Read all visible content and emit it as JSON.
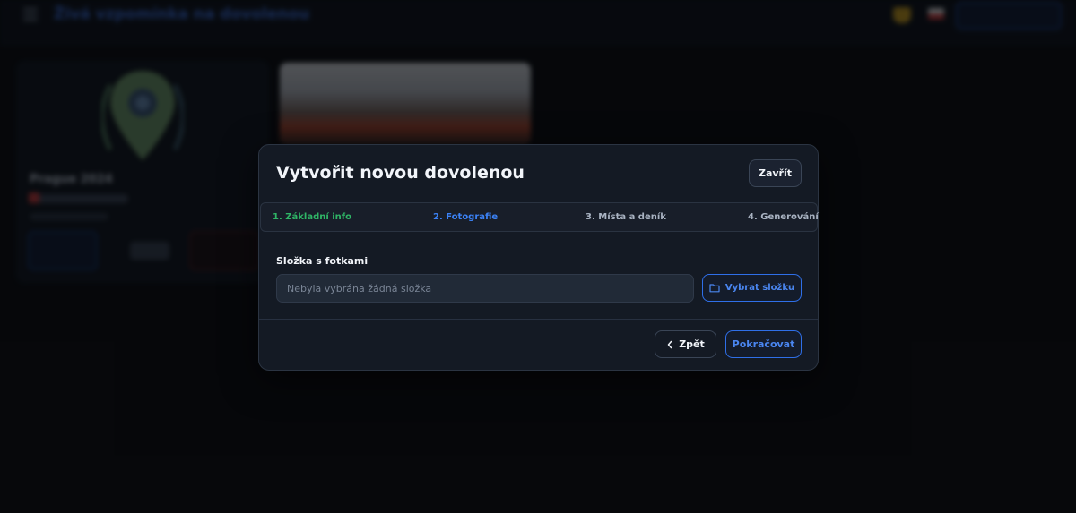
{
  "background": {
    "app_title": "Živá vzpomínka na dovolenou",
    "card_title": "Prague 2024",
    "icons": [
      "menu-icon",
      "trophy-icon",
      "flag-icon",
      "map-pin-icon"
    ]
  },
  "modal": {
    "title": "Vytvořit novou dovolenou",
    "close_label": "Zavřít",
    "steps": [
      {
        "label": "1. Základní info",
        "state": "done",
        "color": "#2fb566"
      },
      {
        "label": "2. Fotografie",
        "state": "active",
        "color": "#3b82f6"
      },
      {
        "label": "3. Místa a deník",
        "state": "pending",
        "color": "#a9b3c2"
      },
      {
        "label": "4. Generování",
        "state": "pending",
        "color": "#a9b3c2"
      }
    ],
    "folder_field": {
      "label": "Složka s fotkami",
      "value": "",
      "placeholder": "Nebyla vybrána žádná složka"
    },
    "choose_folder_label": "Vybrat složku",
    "back_label": "Zpět",
    "continue_label": "Pokračovat"
  },
  "colors": {
    "accent": "#2f6fe8",
    "success": "#2fb566",
    "modal_bg": "#141a24"
  }
}
